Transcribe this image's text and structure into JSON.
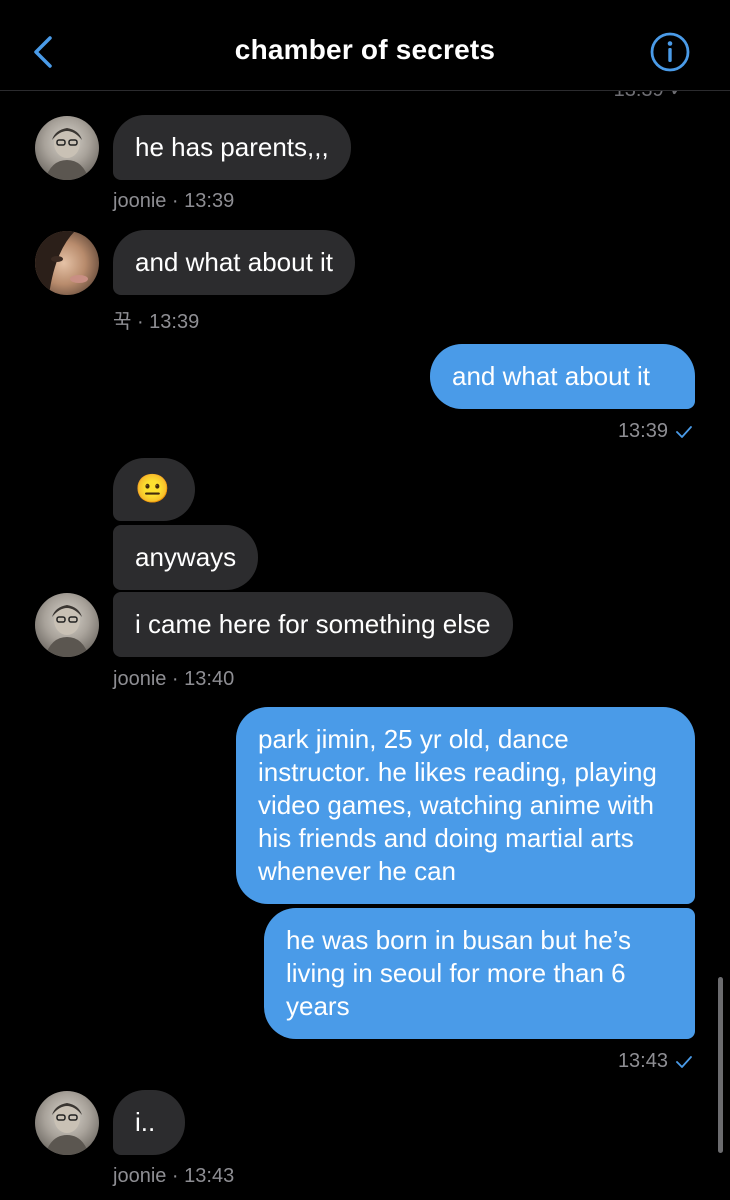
{
  "header": {
    "title": "chamber of secrets",
    "top_peek": "13:39 ✓",
    "accent": "#4a9be8"
  },
  "messages": [
    {
      "sender": "joonie",
      "text": "he has parents,,,",
      "meta": "joonie · 13:39"
    },
    {
      "sender": "꾹",
      "text": "and what about it",
      "meta": "꾹 · 13:39"
    },
    {
      "sender": "me",
      "text": "and what about it",
      "meta": "13:39"
    },
    {
      "sender": "joonie",
      "text": "😐"
    },
    {
      "sender": "joonie",
      "text": "anyways"
    },
    {
      "sender": "joonie",
      "text": "i came here for something else",
      "meta": "joonie · 13:40"
    },
    {
      "sender": "me",
      "text": "park jimin, 25 yr old, dance instructor. he likes reading, playing video games, watching anime with his friends and doing martial arts whenever he can"
    },
    {
      "sender": "me",
      "text": "he was born in busan but he’s living in seoul for more than 6 years",
      "meta": "13:43"
    },
    {
      "sender": "joonie",
      "text": "i..",
      "meta": "joonie · 13:43"
    }
  ],
  "colors": {
    "incoming_bubble": "#2c2c2e",
    "outgoing_bubble": "#4a9be8",
    "meta_text": "#8e8e93"
  }
}
